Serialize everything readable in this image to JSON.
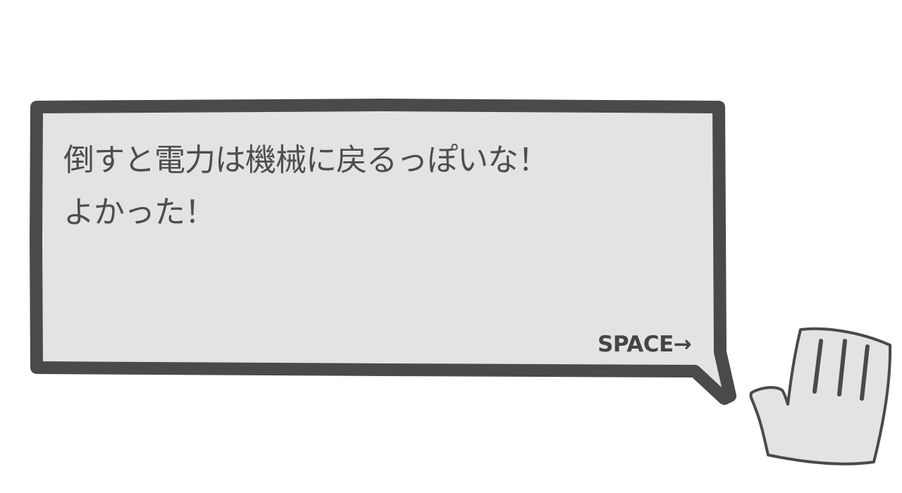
{
  "dialogue": {
    "lines": [
      "倒すと電力は機械に戻るっぽいな！",
      "よかった！"
    ],
    "advance_prompt": "SPACE→"
  },
  "colors": {
    "background": "#ffffff",
    "bubble_fill": "#e3e3e3",
    "bubble_border": "#4a4a4a",
    "text": "#4d4d4d",
    "hand_fill": "#e3e3e3",
    "hand_outline": "#4a4a4a"
  },
  "icons": {
    "speaker": "open-hand-icon"
  }
}
